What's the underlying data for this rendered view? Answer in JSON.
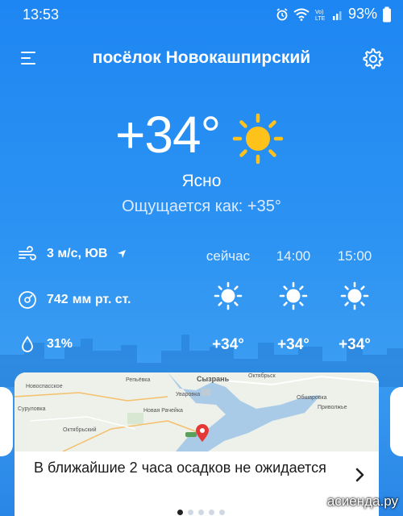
{
  "status_bar": {
    "time": "13:53",
    "battery": "93%"
  },
  "header": {
    "title": "посёлок Новокашпирский"
  },
  "current": {
    "temperature": "+34°",
    "condition": "Ясно",
    "feels_like": "Ощущается как: +35°"
  },
  "details": {
    "wind_value": "3 м/с, ЮВ",
    "pressure_value": "742",
    "pressure_unit": "мм рт. ст.",
    "humidity": "31%"
  },
  "hourly": [
    {
      "label": "сейчас",
      "temp": "+34°",
      "icon": "sun-icon"
    },
    {
      "label": "14:00",
      "temp": "+34°",
      "icon": "sun-icon"
    },
    {
      "label": "15:00",
      "temp": "+34°",
      "icon": "sun-icon"
    }
  ],
  "map": {
    "places": [
      "Репьёвка",
      "Сызрань",
      "Октябрьск",
      "Новоспасское",
      "Уваровка",
      "Суруловка",
      "Новая Рачейка",
      "Обшаровка",
      "Приволжье",
      "Октябрьский"
    ]
  },
  "precipitation": {
    "text": "В ближайшие 2 часа осадков не ожидается"
  },
  "pager": {
    "count": 5,
    "active": 0
  },
  "watermark": "асиенда.ру",
  "colors": {
    "sky": "#2a8cf0",
    "sun": "#ffc21a",
    "card": "#ffffff"
  }
}
